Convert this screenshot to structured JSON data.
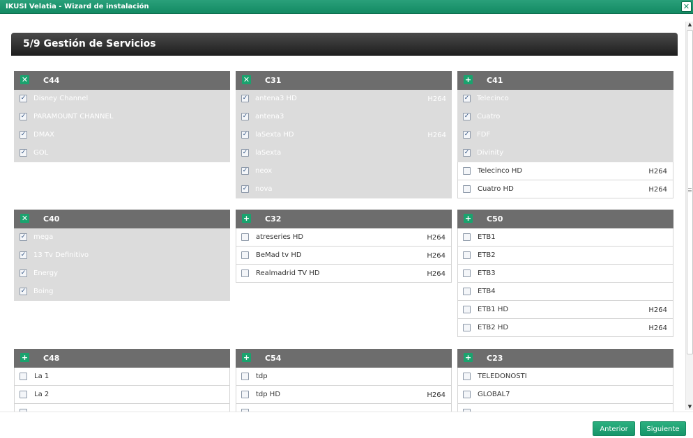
{
  "window": {
    "title": "IKUSI Velatia - Wizard de instalación",
    "close": "✕"
  },
  "step": {
    "title": "5/9 Gestión de Servicios"
  },
  "panels": [
    {
      "name": "C44",
      "toggle": "✕",
      "services": [
        {
          "label": "Disney Channel",
          "codec": "",
          "checked": true
        },
        {
          "label": "PARAMOUNT CHANNEL",
          "codec": "",
          "checked": true
        },
        {
          "label": "DMAX",
          "codec": "",
          "checked": true
        },
        {
          "label": "GOL",
          "codec": "",
          "checked": true
        }
      ]
    },
    {
      "name": "C31",
      "toggle": "✕",
      "services": [
        {
          "label": "antena3 HD",
          "codec": "H264",
          "checked": true
        },
        {
          "label": "antena3",
          "codec": "",
          "checked": true
        },
        {
          "label": "laSexta HD",
          "codec": "H264",
          "checked": true
        },
        {
          "label": "laSexta",
          "codec": "",
          "checked": true
        },
        {
          "label": "neox",
          "codec": "",
          "checked": true
        },
        {
          "label": "nova",
          "codec": "",
          "checked": true
        }
      ]
    },
    {
      "name": "C41",
      "toggle": "+",
      "services": [
        {
          "label": "Telecinco",
          "codec": "",
          "checked": true
        },
        {
          "label": "Cuatro",
          "codec": "",
          "checked": true
        },
        {
          "label": "FDF",
          "codec": "",
          "checked": true
        },
        {
          "label": "Divinity",
          "codec": "",
          "checked": true
        },
        {
          "label": "Telecinco HD",
          "codec": "H264",
          "checked": false
        },
        {
          "label": "Cuatro HD",
          "codec": "H264",
          "checked": false
        }
      ]
    },
    {
      "name": "C40",
      "toggle": "✕",
      "services": [
        {
          "label": "mega",
          "codec": "",
          "checked": true
        },
        {
          "label": "13 Tv Definitivo",
          "codec": "",
          "checked": true
        },
        {
          "label": "Energy",
          "codec": "",
          "checked": true
        },
        {
          "label": "Boing",
          "codec": "",
          "checked": true
        }
      ]
    },
    {
      "name": "C32",
      "toggle": "+",
      "services": [
        {
          "label": "atreseries HD",
          "codec": "H264",
          "checked": false
        },
        {
          "label": "BeMad tv HD",
          "codec": "H264",
          "checked": false
        },
        {
          "label": "Realmadrid TV HD",
          "codec": "H264",
          "checked": false
        }
      ]
    },
    {
      "name": "C50",
      "toggle": "+",
      "services": [
        {
          "label": "ETB1",
          "codec": "",
          "checked": false
        },
        {
          "label": "ETB2",
          "codec": "",
          "checked": false
        },
        {
          "label": "ETB3",
          "codec": "",
          "checked": false
        },
        {
          "label": "ETB4",
          "codec": "",
          "checked": false
        },
        {
          "label": "ETB1 HD",
          "codec": "H264",
          "checked": false
        },
        {
          "label": "ETB2 HD",
          "codec": "H264",
          "checked": false
        }
      ]
    },
    {
      "name": "C48",
      "toggle": "+",
      "services": [
        {
          "label": "La 1",
          "codec": "",
          "checked": false
        },
        {
          "label": "La 2",
          "codec": "",
          "checked": false
        },
        {
          "label": "",
          "codec": "",
          "checked": false
        }
      ]
    },
    {
      "name": "C54",
      "toggle": "+",
      "services": [
        {
          "label": "tdp",
          "codec": "",
          "checked": false
        },
        {
          "label": "tdp HD",
          "codec": "H264",
          "checked": false
        },
        {
          "label": "",
          "codec": "",
          "checked": false
        }
      ]
    },
    {
      "name": "C23",
      "toggle": "+",
      "services": [
        {
          "label": "TELEDONOSTI",
          "codec": "",
          "checked": false
        },
        {
          "label": "GLOBAL7",
          "codec": "",
          "checked": false
        },
        {
          "label": "",
          "codec": "",
          "checked": false
        }
      ]
    }
  ],
  "footer": {
    "prev": "Anterior",
    "next": "Siguiente"
  },
  "colors": {
    "accent": "#1aa36e",
    "panel_header": "#6d6d6d",
    "selected_row": "#dcdcdc"
  }
}
